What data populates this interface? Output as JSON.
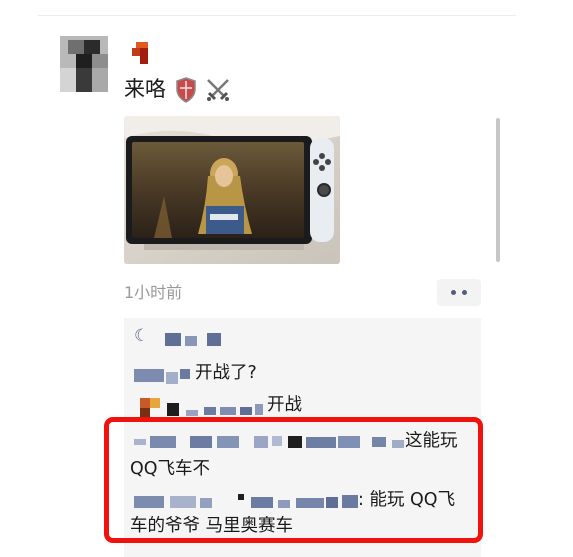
{
  "post": {
    "text": "来咯",
    "emoji": [
      "shield-emoji",
      "crossed-swords-emoji"
    ],
    "timestamp": "1小时前"
  },
  "comments": {
    "like_icon": "like-icon",
    "items": [
      {
        "text": "开战了?"
      },
      {
        "text": "开战"
      },
      {
        "text_line1": "这能玩",
        "text_line2": "QQ飞车不"
      },
      {
        "text_line1": ": 能玩 QQ飞",
        "text_line2": "车的爷爷 马里奥赛车"
      }
    ]
  },
  "colors": {
    "highlight_border": "#f0120c",
    "comment_background": "#f5f5f5",
    "timestamp": "#9a9a9a",
    "link_blue": "#5a6a8f"
  }
}
